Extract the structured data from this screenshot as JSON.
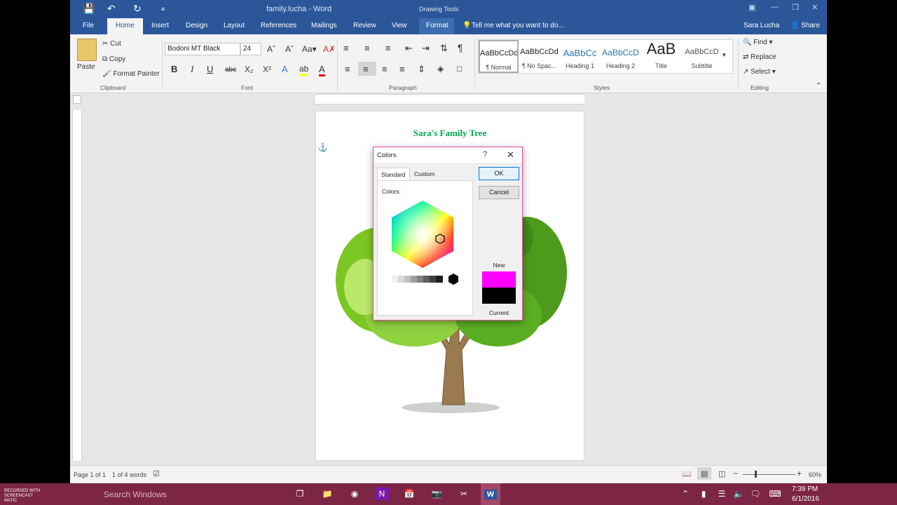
{
  "window": {
    "title": "family.lucha - Word",
    "contextual_group": "Drawing Tools",
    "user": "Sara Lucha",
    "share_label": "Share",
    "tell_me_placeholder": "Tell me what you want to do...",
    "accent": "#2b579a"
  },
  "tabs": [
    "File",
    "Home",
    "Insert",
    "Design",
    "Layout",
    "References",
    "Mailings",
    "Review",
    "View",
    "Format"
  ],
  "active_tab": "Home",
  "ribbon": {
    "clipboard": {
      "paste": "Paste",
      "cut": "Cut",
      "copy": "Copy",
      "format_painter": "Format Painter",
      "label": "Clipboard"
    },
    "font": {
      "name": "Bodoni MT Black",
      "size": "24",
      "label": "Font",
      "bold": "B",
      "italic": "I",
      "underline": "U",
      "strike": "abc",
      "sub": "X₂",
      "sup": "X²"
    },
    "paragraph": {
      "label": "Paragraph"
    },
    "styles": {
      "label": "Styles",
      "items": [
        {
          "preview": "AaBbCcDd",
          "name": "¶ Normal"
        },
        {
          "preview": "AaBbCcDd",
          "name": "¶ No Spac..."
        },
        {
          "preview": "AaBbCc",
          "name": "Heading 1"
        },
        {
          "preview": "AaBbCcD",
          "name": "Heading 2"
        },
        {
          "preview": "AaB",
          "name": "Title"
        },
        {
          "preview": "AaBbCcD",
          "name": "Subtitle"
        }
      ]
    },
    "editing": {
      "find": "Find",
      "replace": "Replace",
      "select": "Select",
      "label": "Editing"
    }
  },
  "document": {
    "title": "Sara's Family Tree",
    "title_color": "#00a651"
  },
  "dialog": {
    "title": "Colors",
    "help": "?",
    "tabs": [
      "Standard",
      "Custom"
    ],
    "active_tab": "Standard",
    "colors_label": "Colors:",
    "ok": "OK",
    "cancel": "Cancel",
    "new_label": "New",
    "current_label": "Current",
    "new_color": "#ff00ff",
    "current_color": "#000000"
  },
  "statusbar": {
    "page": "Page 1 of 1",
    "words": "1 of 4 words",
    "zoom": "60%"
  },
  "taskbar": {
    "search_placeholder": "Search Windows",
    "watermark": "RECORDED WITH SCREENCAST MATIC",
    "time": "7:39 PM",
    "date": "6/1/2016"
  }
}
